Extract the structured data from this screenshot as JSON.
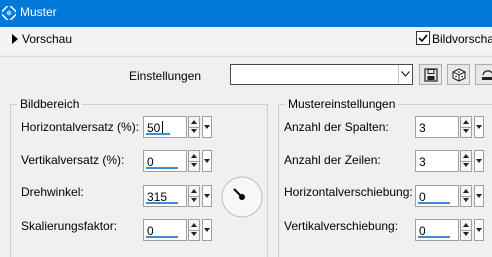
{
  "window": {
    "title": "Muster"
  },
  "preview": {
    "label": "Vorschau",
    "checkbox_label": "Bildvorschau",
    "checked": true
  },
  "settings": {
    "label": "Einstellungen",
    "preset_value": ""
  },
  "bildbereich": {
    "title": "Bildbereich",
    "fields": [
      {
        "label": "Horizontalversatz (%):",
        "value": "50"
      },
      {
        "label": "Vertikalversatz (%):",
        "value": "0"
      },
      {
        "label": "Drehwinkel:",
        "value": "315"
      },
      {
        "label": "Skalierungsfaktor:",
        "value": "0"
      }
    ]
  },
  "mustereinstellungen": {
    "title": "Mustereinstellungen",
    "fields": [
      {
        "label": "Anzahl der Spalten:",
        "value": "3"
      },
      {
        "label": "Anzahl der Zeilen:",
        "value": "3"
      },
      {
        "label": "Horizontalverschiebung:",
        "value": "0"
      },
      {
        "label": "Vertikalverschiebung:",
        "value": "0"
      }
    ]
  },
  "colors": {
    "titlebar": "#0078d7",
    "accent": "#3b8fd8"
  },
  "icons": [
    "pattern-app-icon",
    "checkmark-icon",
    "dropdown-arrow-icon",
    "save-icon",
    "randomize-icon",
    "reset-icon",
    "angle-dial-icon"
  ]
}
